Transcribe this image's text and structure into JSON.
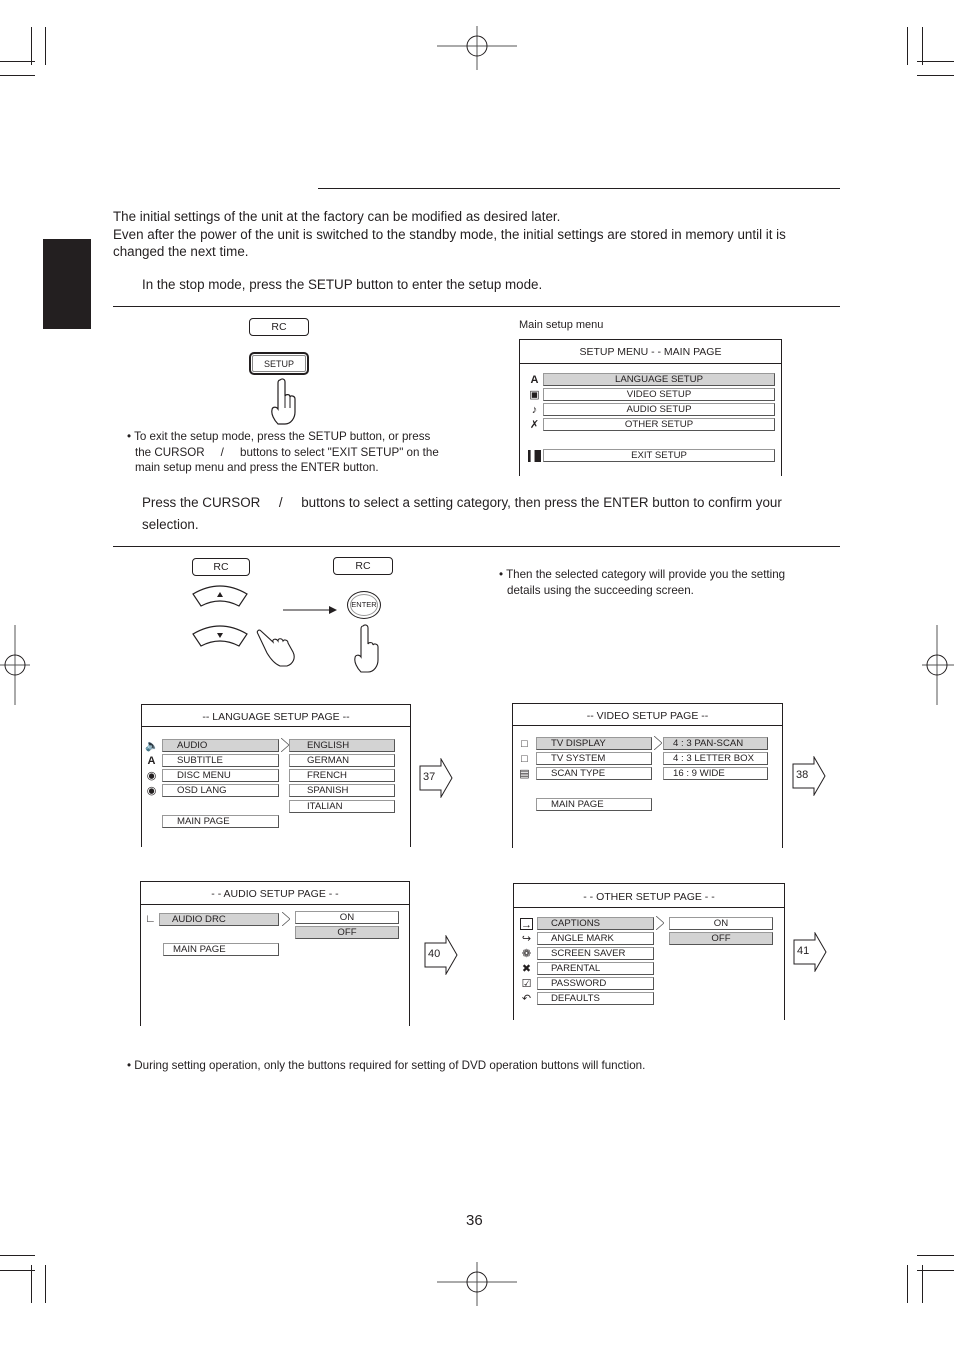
{
  "intro": {
    "line1": "The initial settings of the unit at the factory can be modified as desired later.",
    "line2": "Even after the power of the unit is switched to the standby mode, the initial settings are stored in memory until it is",
    "line3": "changed the next time.",
    "step1": "In the stop mode, press the SETUP button to enter the setup mode."
  },
  "step1_panel": {
    "rc_label": "RC",
    "setup_button_label": "SETUP",
    "note_line1": "• To exit the setup mode, press the SETUP button, or press",
    "note_line2": "the CURSOR     /     buttons to select \"EXIT SETUP\" on the",
    "note_line3": "main setup menu and press the ENTER button.",
    "main_menu_caption": "Main setup menu",
    "main_menu": {
      "title": "SETUP MENU - - MAIN PAGE",
      "items": [
        {
          "label": "LANGUAGE SETUP",
          "icon": "language-icon",
          "selected": true
        },
        {
          "label": "VIDEO SETUP",
          "icon": "monitor-icon",
          "selected": false
        },
        {
          "label": "AUDIO SETUP",
          "icon": "speaker-icon",
          "selected": false
        },
        {
          "label": "OTHER SETUP",
          "icon": "tools-icon",
          "selected": false
        }
      ],
      "exit_label": "EXIT SETUP",
      "exit_icon": "exit-door-icon"
    }
  },
  "step2": {
    "line1": "Press the CURSOR     /     buttons to select a setting category, then press the ENTER button to confirm your",
    "line2": "selection."
  },
  "step2_panel": {
    "rc_label_left": "RC",
    "rc_label_right": "RC",
    "enter_label": "ENTER",
    "note_line1": "• Then the selected category will provide you the setting",
    "note_line2": "details using the succeeding screen."
  },
  "language_page": {
    "title": "-- LANGUAGE  SETUP PAGE --",
    "items": [
      "AUDIO",
      "SUBTITLE",
      "DISC MENU",
      "OSD LANG"
    ],
    "options": [
      "ENGLISH",
      "GERMAN",
      "FRENCH",
      "SPANISH",
      "ITALIAN"
    ],
    "main_page": "MAIN PAGE",
    "ref_page": "37"
  },
  "video_page": {
    "title": "-- VIDEO  SETUP  PAGE --",
    "items": [
      "TV DISPLAY",
      "TV SYSTEM",
      "SCAN TYPE"
    ],
    "options": [
      "4 : 3 PAN-SCAN",
      "4 : 3 LETTER BOX",
      "16 : 9 WIDE"
    ],
    "main_page": "MAIN PAGE",
    "ref_page": "38"
  },
  "audio_page": {
    "title": "- - AUDIO SETUP PAGE - -",
    "items": [
      "AUDIO DRC"
    ],
    "options": [
      "ON",
      "OFF"
    ],
    "main_page": "MAIN PAGE",
    "ref_page": "40"
  },
  "other_page": {
    "title": "- - OTHER SETUP PAGE - -",
    "items": [
      "CAPTIONS",
      "ANGLE MARK",
      "SCREEN SAVER",
      "PARENTAL",
      "PASSWORD",
      "DEFAULTS"
    ],
    "options": [
      "ON",
      "OFF"
    ],
    "ref_page": "41"
  },
  "footer_note": "• During setting operation, only the buttons required for setting of DVD operation buttons will function.",
  "page_number": "36"
}
